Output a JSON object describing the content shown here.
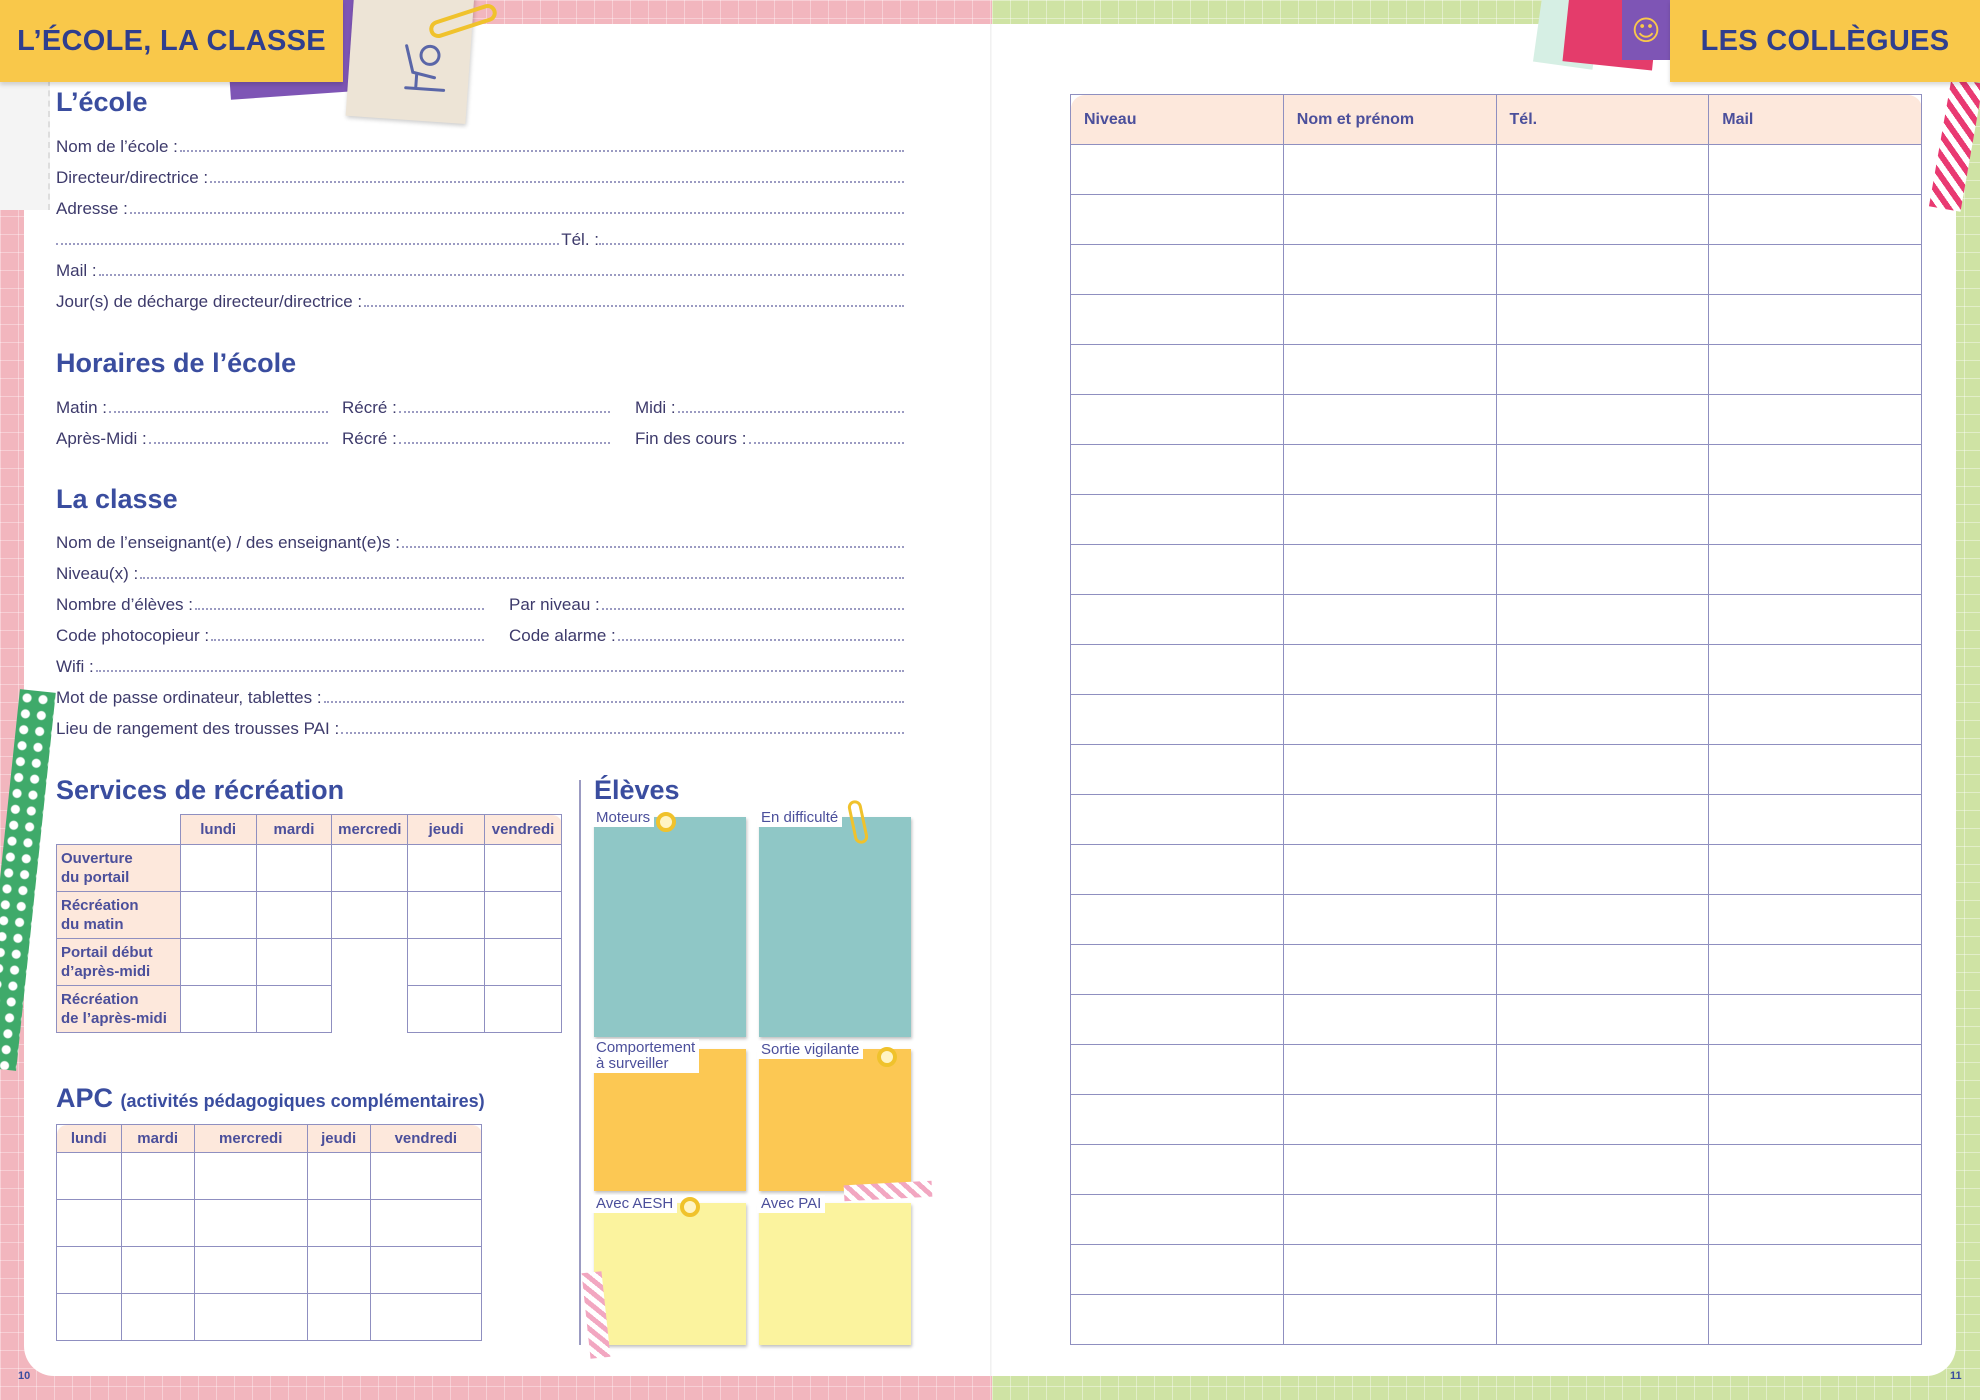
{
  "left_page": {
    "banner": "L’ÉCOLE, LA CLASSE",
    "page_number": "10",
    "ecole": {
      "title": "L’école",
      "fields": [
        "Nom de l’école :",
        "Directeur/directrice :",
        "Adresse :",
        "",
        "Mail :",
        "Jour(s) de décharge directeur/directrice :"
      ],
      "tel": "Tél. :"
    },
    "horaires": {
      "title": "Horaires de l’école",
      "row1": [
        "Matin :",
        "Récré :",
        "Midi :"
      ],
      "row2": [
        "Après-Midi :",
        "Récré :",
        "Fin des cours :"
      ]
    },
    "classe": {
      "title": "La classe",
      "enseignant": "Nom de l’enseignant(e) / des enseignant(e)s :",
      "niveaux": "Niveau(x) :",
      "nb_eleves": "Nombre d’élèves :",
      "par_niveau": "Par niveau :",
      "code_photo": "Code photocopieur :",
      "code_alarme": "Code alarme :",
      "wifi": "Wifi :",
      "mdp": "Mot de passe ordinateur, tablettes :",
      "pai": "Lieu de rangement des trousses PAI :"
    },
    "recreation": {
      "title": "Services de récréation",
      "days": [
        "lundi",
        "mardi",
        "mercredi",
        "jeudi",
        "vendredi"
      ],
      "rows": [
        [
          "Ouverture",
          "du portail"
        ],
        [
          "Récréation",
          "du matin"
        ],
        [
          "Portail début",
          "d’après-midi"
        ],
        [
          "Récréation",
          "de l’après-midi"
        ]
      ]
    },
    "apc": {
      "title": "APC",
      "subtitle": "(activités pédagogiques complémentaires)",
      "days": [
        "lundi",
        "mardi",
        "mercredi",
        "jeudi",
        "vendredi"
      ]
    },
    "eleves": {
      "title": "Élèves",
      "notes": [
        {
          "label": "Moteurs",
          "color": "#8fc7c6"
        },
        {
          "label": "En difficulté",
          "color": "#8fc7c6"
        },
        {
          "label": "Comportement",
          "label2": "à surveiller",
          "color": "#fcc853"
        },
        {
          "label": "Sortie vigilante",
          "color": "#fcc853"
        },
        {
          "label": "Avec AESH",
          "color": "#fbf39e"
        },
        {
          "label": "Avec PAI",
          "color": "#fbf39e"
        }
      ]
    }
  },
  "right_page": {
    "banner": "LES COLLÈGUES",
    "page_number": "11",
    "table_headers": [
      "Niveau",
      "Nom et prénom",
      "Tél.",
      "Mail"
    ]
  },
  "colors": {
    "accent": "#3a4d9f",
    "banner": "#f9c84a",
    "header_cell": "#fde8dc",
    "left_bg": "#f2b6be",
    "right_bg": "#cfe3a4"
  }
}
